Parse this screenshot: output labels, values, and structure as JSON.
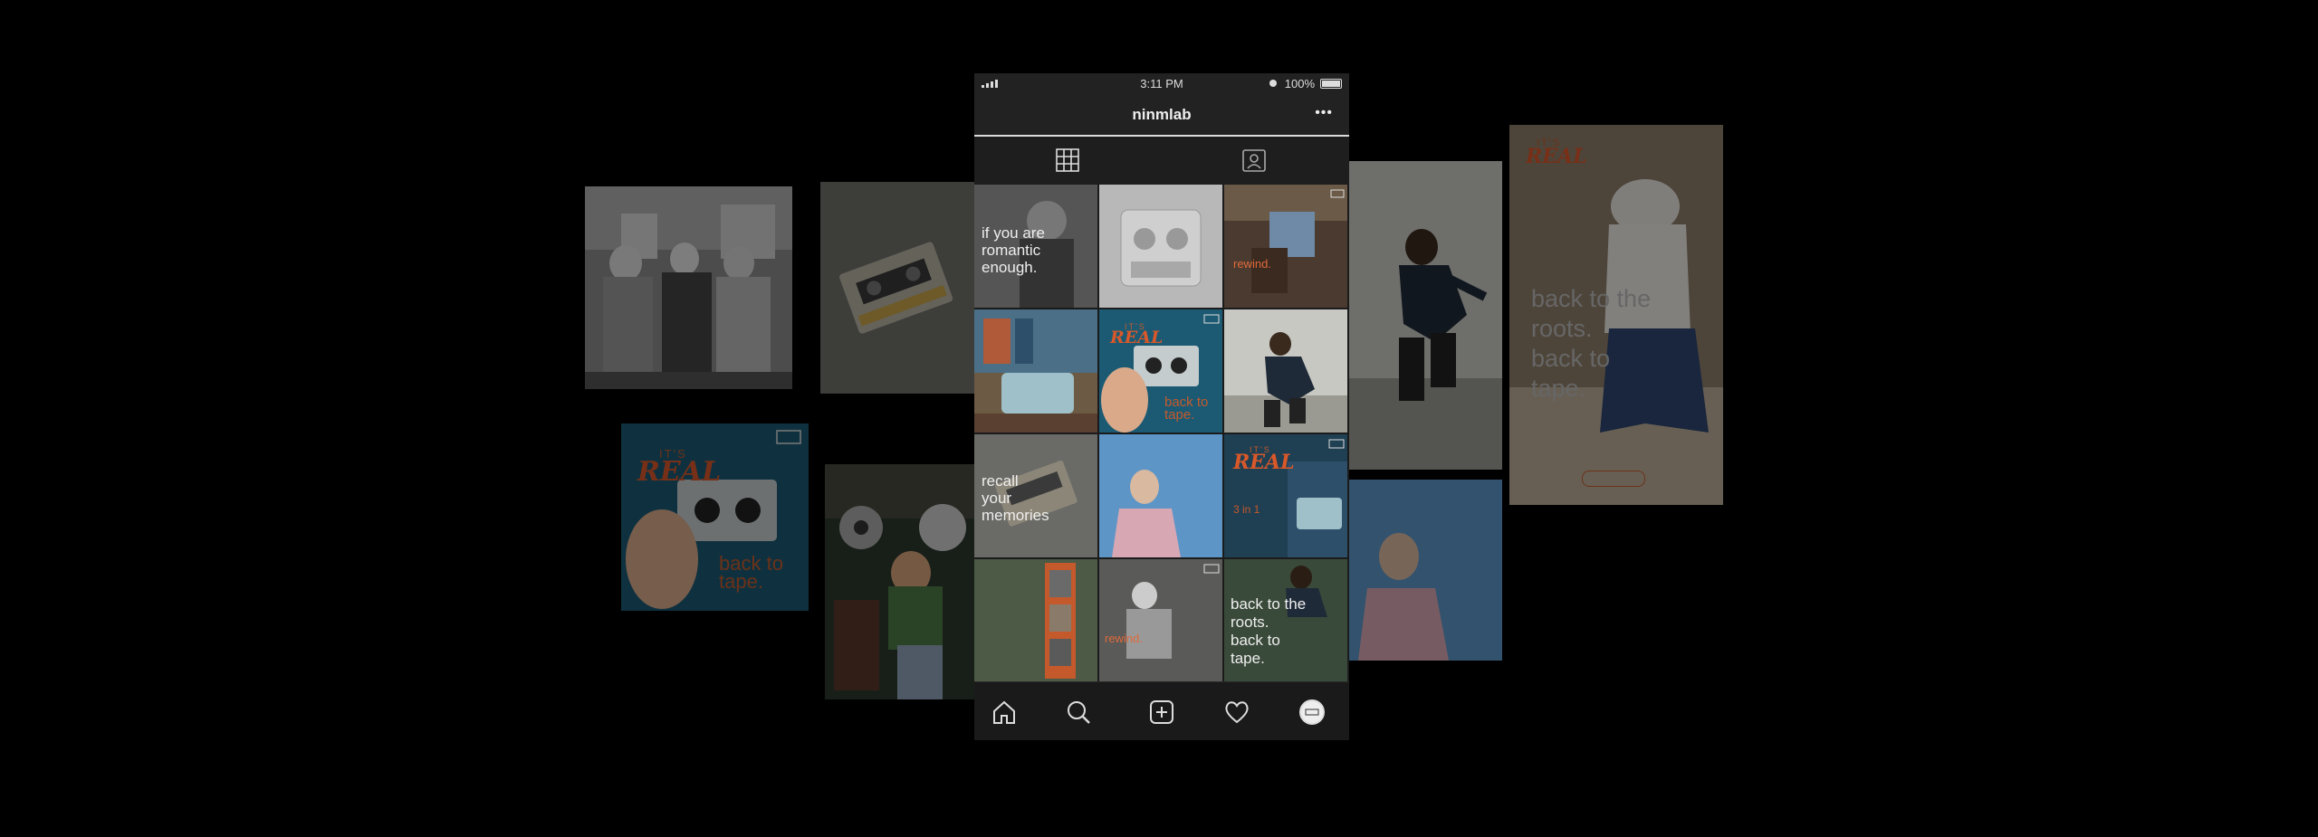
{
  "status": {
    "time": "3:11 PM",
    "battery": "100%"
  },
  "profile": {
    "username": "ninmlab",
    "more": "•••"
  },
  "tabs": [
    {
      "name": "grid"
    },
    {
      "name": "tagged"
    }
  ],
  "posts": {
    "p1": "if you are\nromantic\nenough.",
    "p3": "rewind.",
    "p5_small": "IT'S",
    "p5_script": "REAL",
    "p5": "back to\ntape.",
    "p7": "recall\nyour\nmemories",
    "p9_small": "IT'S",
    "p9_script": "REAL",
    "p9": "3 in 1",
    "p11": "rewind.",
    "p12": "back to the\nroots.\nback to\ntape."
  },
  "side_tiles": {
    "left_blue_small": "IT'S",
    "left_blue_script": "REAL",
    "left_blue_text": "back to\ntape.",
    "right_tall_small": "IT'S",
    "right_tall_script": "REAL",
    "right_tall_text": "back to the\nroots.\nback to\ntape."
  },
  "icons": {
    "nav": [
      "home-icon",
      "search-icon",
      "add-icon",
      "heart-icon",
      "profile-icon"
    ]
  },
  "colors": {
    "accent": "#d9582a",
    "teal": "#1c5a73",
    "background": "#000000"
  }
}
